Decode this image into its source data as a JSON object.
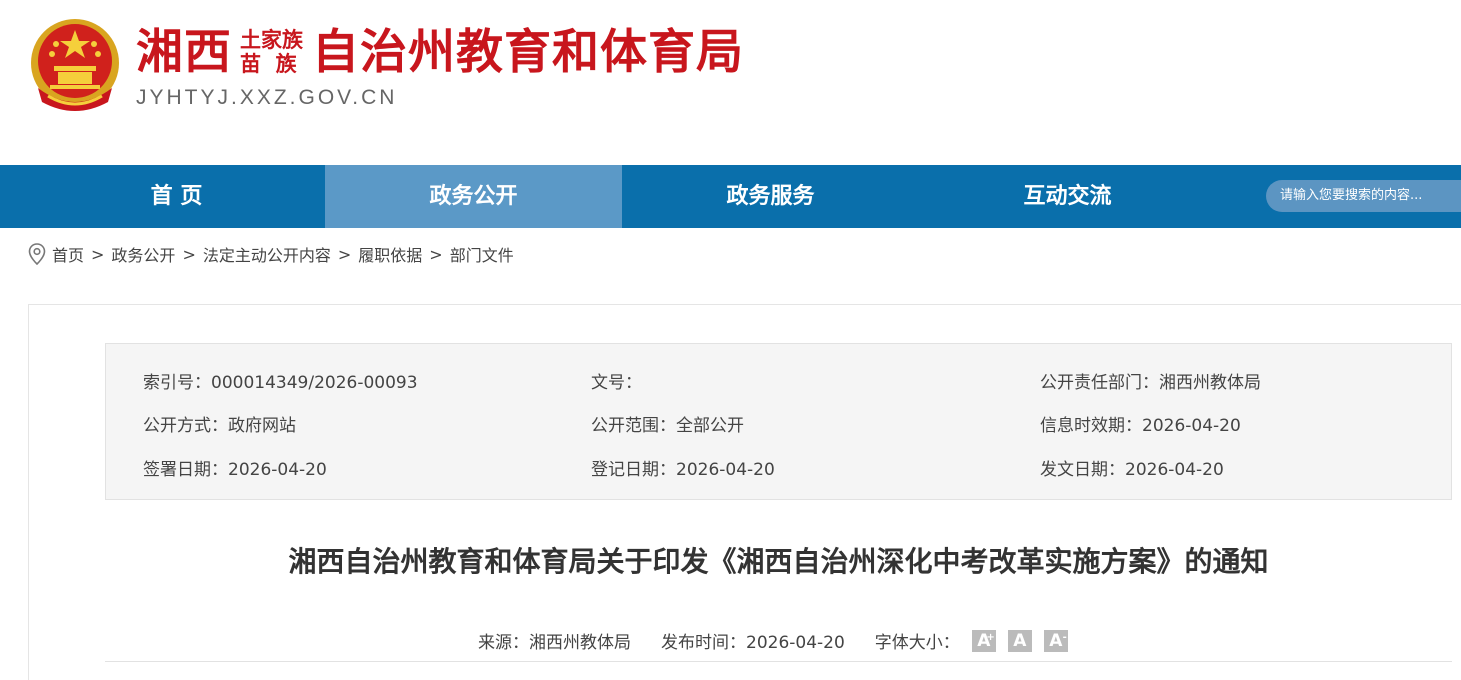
{
  "header": {
    "title_prefix": "湘西",
    "title_small_line1": "土家族",
    "title_small_line2": "苗  族",
    "title_rest": "自治州教育和体育局",
    "domain": "JYHTYJ.XXZ.GOV.CN"
  },
  "nav": {
    "items": [
      {
        "label": "首 页"
      },
      {
        "label": "政务公开"
      },
      {
        "label": "政务服务"
      },
      {
        "label": "互动交流"
      }
    ],
    "active_index": 1,
    "search_placeholder": "请输入您要搜索的内容..."
  },
  "breadcrumb": [
    "首页",
    "政务公开",
    "法定主动公开内容",
    "履职依据",
    "部门文件"
  ],
  "info": {
    "index_no": "索引号：000014349/2026-00093",
    "doc_no": "文号：",
    "dept": "公开责任部门：湘西州教体局",
    "method": "公开方式：政府网站",
    "scope": "公开范围：全部公开",
    "valid_date": "信息时效期：2026-04-20",
    "sign_date": "签署日期：2026-04-20",
    "reg_date": "登记日期：2026-04-20",
    "issue_date": "发文日期：2026-04-20"
  },
  "article": {
    "title": "湘西自治州教育和体育局关于印发《湘西自治州深化中考改革实施方案》的通知",
    "source": "来源：湘西州教体局",
    "publish_time": "发布时间：2026-04-20",
    "font_size_label": "字体大小：",
    "font_buttons": [
      "A",
      "A",
      "A"
    ],
    "font_button_marks": [
      "+",
      "",
      "-"
    ]
  },
  "colors": {
    "brand_red": "#c8161d",
    "nav_blue": "#0a6fab",
    "nav_active": "#5b99c7"
  }
}
